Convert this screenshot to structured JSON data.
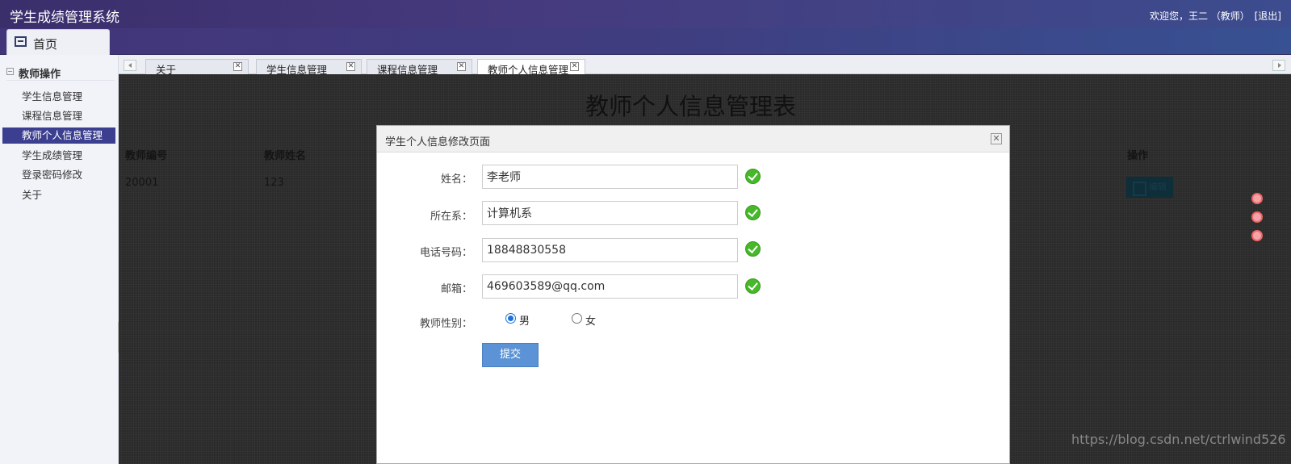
{
  "header": {
    "app_title": "学生成绩管理系统",
    "welcome": "欢迎您，王二 （教师）",
    "logout": "[退出]"
  },
  "top_tabs": {
    "home": "首页"
  },
  "sidebar": {
    "title": "教师操作",
    "items": [
      {
        "label": "学生信息管理"
      },
      {
        "label": "课程信息管理"
      },
      {
        "label": "教师个人信息管理",
        "active": true
      },
      {
        "label": "学生成绩管理"
      },
      {
        "label": "登录密码修改"
      },
      {
        "label": "关于"
      }
    ]
  },
  "content_tabs": [
    {
      "label": "关于"
    },
    {
      "label": "学生信息管理"
    },
    {
      "label": "课程信息管理"
    },
    {
      "label": "教师个人信息管理",
      "active": true
    }
  ],
  "page": {
    "title": "教师个人信息管理表",
    "columns": [
      "教师编号",
      "教师姓名",
      "操作"
    ],
    "row": {
      "id": "20001",
      "name": "123",
      "action": "编辑"
    }
  },
  "modal": {
    "title": "学生个人信息修改页面",
    "fields": [
      {
        "label": "姓名：",
        "value": "李老师"
      },
      {
        "label": "所在系：",
        "value": "计算机系"
      },
      {
        "label": "电话号码：",
        "value": "18848830558"
      },
      {
        "label": "邮箱：",
        "value": "469603589@qq.com"
      }
    ],
    "gender_label": "教师性别：",
    "gender_options": [
      {
        "label": "男",
        "checked": true
      },
      {
        "label": "女",
        "checked": false
      }
    ],
    "submit": "提交"
  },
  "watermark": "https://blog.csdn.net/ctrlwind526",
  "colors": {
    "header": "#3a2e6b",
    "active_item": "#3c3f8f",
    "submit": "#5b93d6",
    "check": "#46b829",
    "overlay": "#2b2b2b"
  }
}
